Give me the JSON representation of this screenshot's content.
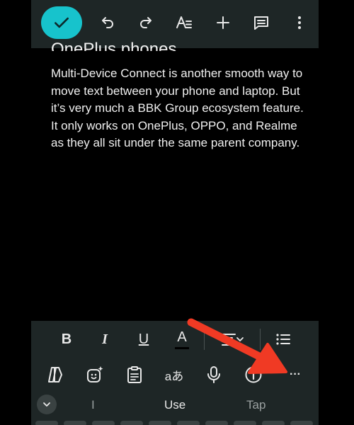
{
  "document": {
    "heading_fragment": "OnePlus phones",
    "paragraph": "Multi-Device Connect is another smooth way to move text between your phone and laptop. But it’s very much a BBK Group ecosystem feature. It only works on OnePlus, OPPO, and Realme as they all sit under the same parent company."
  },
  "formatting": {
    "bold": "B",
    "italic": "I",
    "underline": "U",
    "text_color": "A"
  },
  "keyboard": {
    "translate_glyph": "aあ",
    "more_glyph": "···"
  },
  "suggestions": [
    "I",
    "Use",
    "Tap"
  ],
  "colors": {
    "toolbar_bg": "#1e2626",
    "accent": "#17c3cc",
    "annotation_arrow": "#f03a24"
  }
}
